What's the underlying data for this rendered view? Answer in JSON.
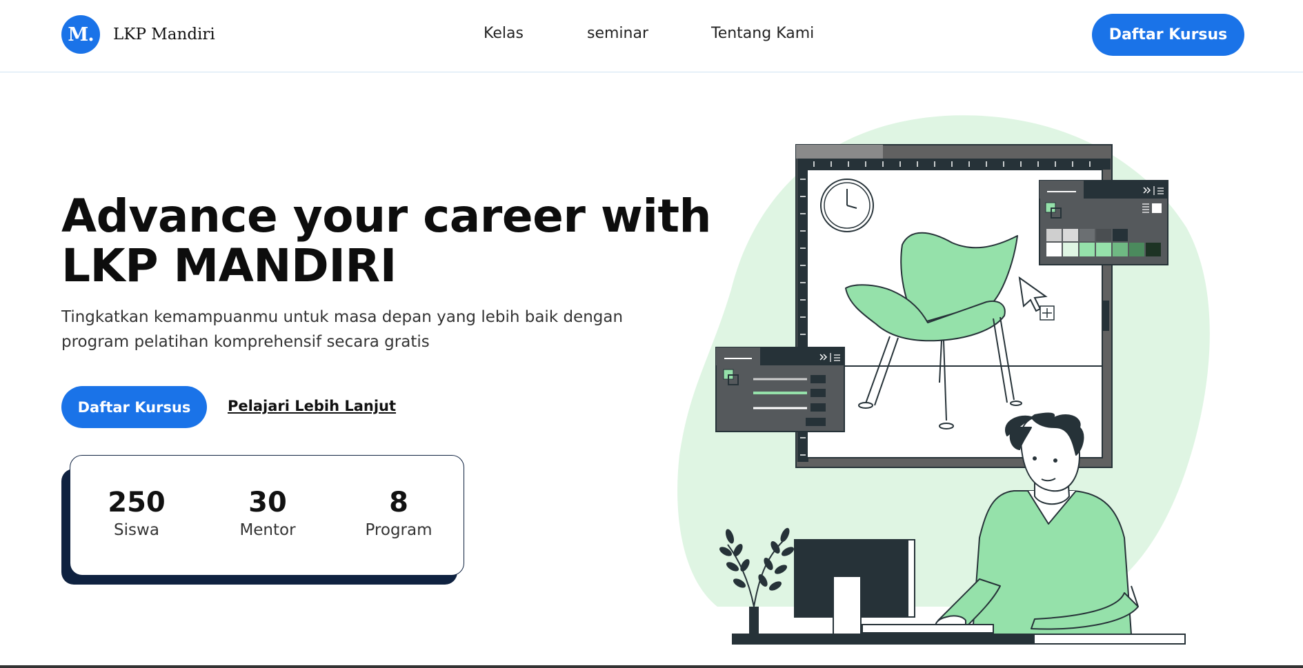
{
  "brand": {
    "logo_mark": "M.",
    "name": "LKP Mandiri"
  },
  "nav": {
    "items": [
      "Kelas",
      "seminar",
      "Tentang Kami"
    ]
  },
  "header": {
    "cta_label": "Daftar Kursus"
  },
  "hero": {
    "title_line1": "Advance your career with",
    "title_line2": "LKP MANDIRI",
    "subtitle_line1": "Tingkatkan kemampuanmu untuk masa depan yang lebih baik dengan",
    "subtitle_line2": "program pelatihan komprehensif secara gratis",
    "primary_cta": "Daftar Kursus",
    "secondary_cta": "Pelajari Lebih Lanjut"
  },
  "stats": [
    {
      "value": "250",
      "label": "Siswa"
    },
    {
      "value": "30",
      "label": "Mentor"
    },
    {
      "value": "8",
      "label": "Program"
    }
  ],
  "colors": {
    "accent": "#1a73e8",
    "navy": "#0f2240",
    "mint": "#95e1aa",
    "blob": "#dff5e3",
    "dark": "#263238"
  },
  "illustration": {
    "icon": "designer-at-computer-illustration"
  }
}
